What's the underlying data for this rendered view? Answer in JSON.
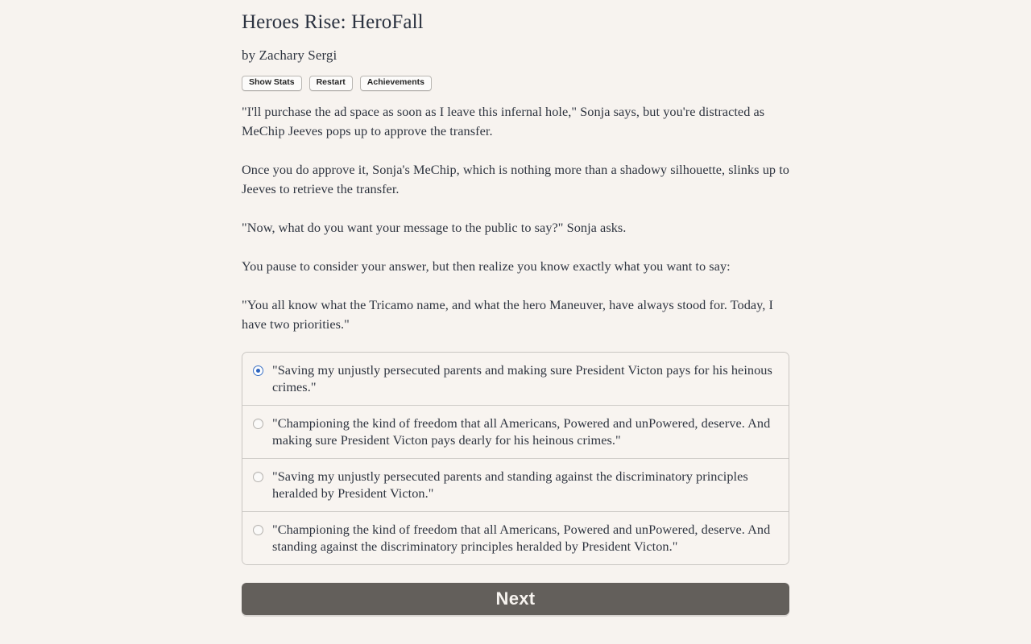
{
  "header": {
    "title": "Heroes Rise: HeroFall",
    "byline": "by Zachary Sergi"
  },
  "toolbar": {
    "buttons": [
      {
        "label": "Show Stats",
        "name": "show-stats-button"
      },
      {
        "label": "Restart",
        "name": "restart-button"
      },
      {
        "label": "Achievements",
        "name": "achievements-button"
      }
    ]
  },
  "story": {
    "paragraphs": [
      "\"I'll purchase the ad space as soon as I leave this infernal hole,\" Sonja says, but you're distracted as MeChip Jeeves pops up to approve the transfer.",
      "Once you do approve it, Sonja's MeChip, which is nothing more than a shadowy silhouette, slinks up to Jeeves to retrieve the transfer.",
      "\"Now, what do you want your message to the public to say?\" Sonja asks.",
      "You pause to consider your answer, but then realize you know exactly what you want to say:",
      "\"You all know what the Tricamo name, and what the hero Maneuver, have always stood for. Today, I have two priorities.\""
    ]
  },
  "choices": {
    "selected_index": 0,
    "options": [
      {
        "text": "\"Saving my unjustly persecuted parents and making sure President Victon pays for his heinous crimes.\"",
        "selected": true
      },
      {
        "text": "\"Championing the kind of freedom that all Americans, Powered and unPowered, deserve. And making sure President Victon pays dearly for his heinous crimes.\"",
        "selected": false
      },
      {
        "text": "\"Saving my unjustly persecuted parents and standing against the discriminatory principles heralded by President Victon.\"",
        "selected": false
      },
      {
        "text": "\"Championing the kind of freedom that all Americans, Powered and unPowered, deserve. And standing against the discriminatory principles heralded by President Victon.\"",
        "selected": false
      }
    ]
  },
  "footer": {
    "next_label": "Next"
  },
  "colors": {
    "page_background": "#f7f3ef",
    "text": "#2f3540",
    "title": "#2b3240",
    "radio_accent": "#2d64bf",
    "next_button_background": "#635f5b",
    "next_button_text": "#f7f3ef",
    "choice_border": "#c9c6c2"
  }
}
